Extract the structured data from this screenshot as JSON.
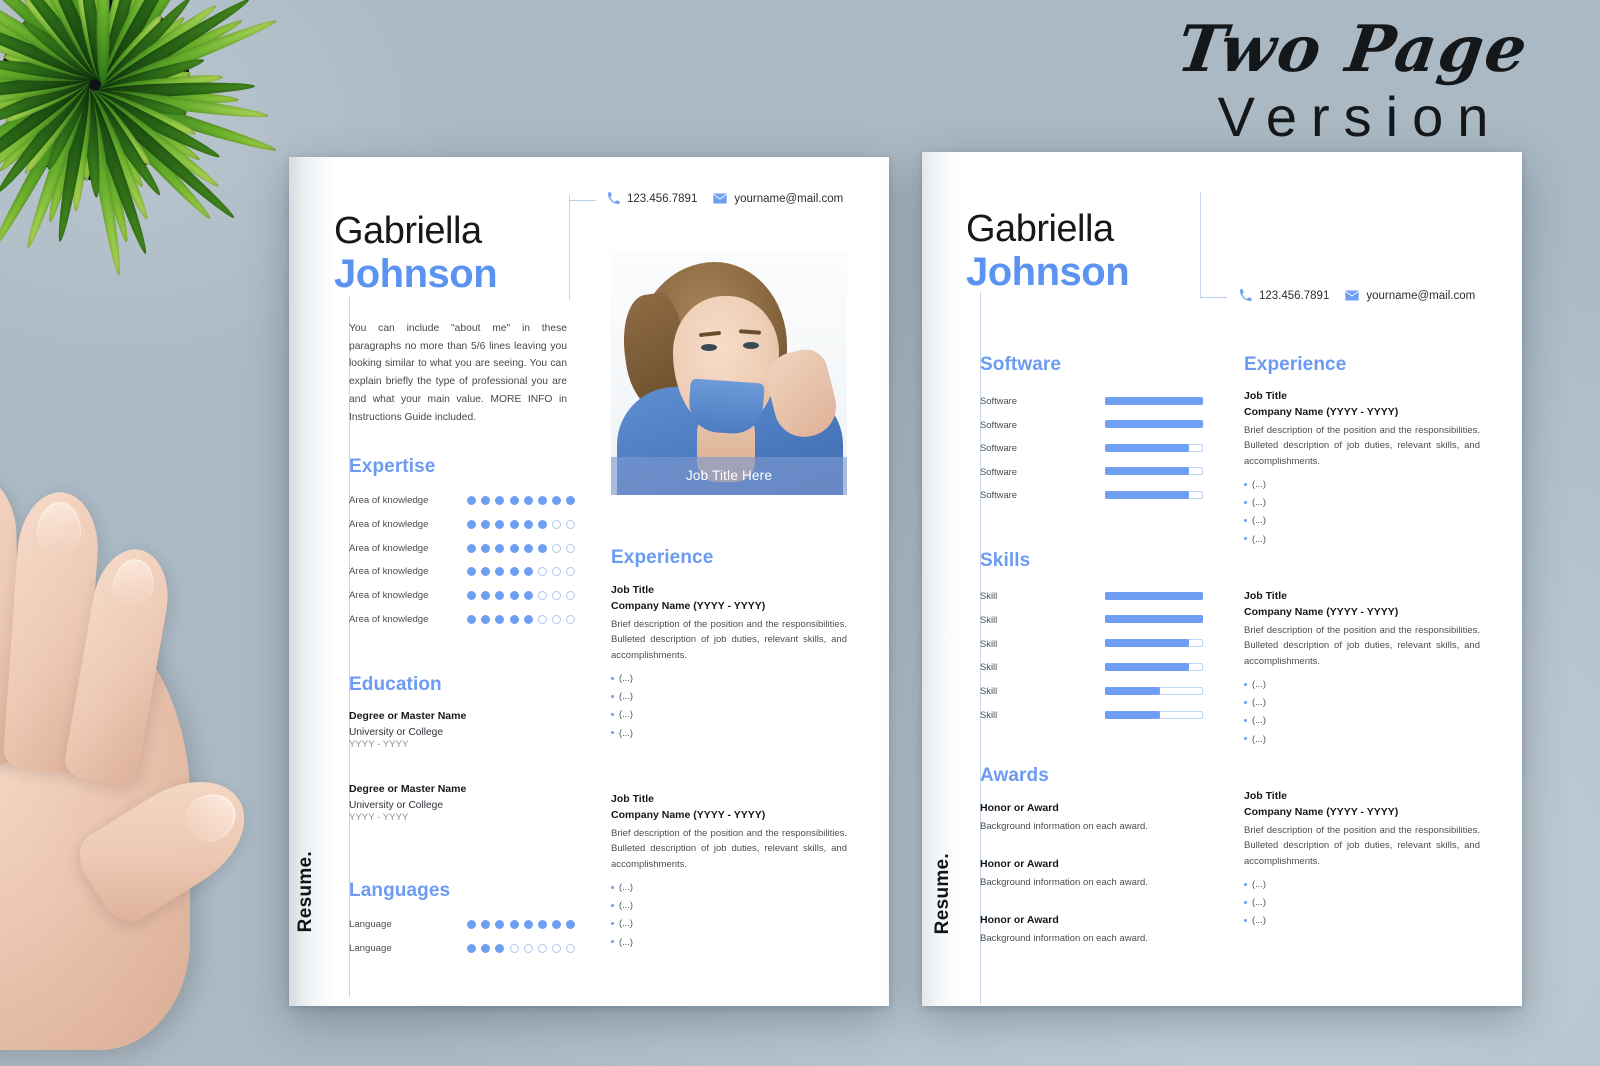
{
  "headline": {
    "line1": "Two Page",
    "line2": "Version"
  },
  "brand_color": "#6b9bf2",
  "side_label": "Resume.",
  "person": {
    "first_name": "Gabriella",
    "last_name": "Johnson"
  },
  "contact": {
    "phone": "123.456.7891",
    "email": "yourname@mail.com",
    "phone_icon": "phone-icon",
    "email_icon": "envelope-icon"
  },
  "page1": {
    "about": "You can include \"about me\" in these paragraphs no more than 5/6 lines leaving you looking similar to what you are seeing. You can explain briefly the type of professional you are and what your main value. MORE INFO in Instructions Guide included.",
    "photo_caption": "Job Title Here",
    "expertise": {
      "heading": "Expertise",
      "max": 8,
      "items": [
        {
          "label": "Area of knowledge",
          "value": 8
        },
        {
          "label": "Area of knowledge",
          "value": 6
        },
        {
          "label": "Area of knowledge",
          "value": 6
        },
        {
          "label": "Area of knowledge",
          "value": 5
        },
        {
          "label": "Area of knowledge",
          "value": 5
        },
        {
          "label": "Area of knowledge",
          "value": 5
        }
      ]
    },
    "education": {
      "heading": "Education",
      "items": [
        {
          "degree": "Degree or Master Name",
          "school": "University or College",
          "years": "YYYY - YYYY"
        },
        {
          "degree": "Degree or Master Name",
          "school": "University or College",
          "years": "YYYY - YYYY"
        }
      ]
    },
    "languages": {
      "heading": "Languages",
      "max": 8,
      "items": [
        {
          "label": "Language",
          "value": 8
        },
        {
          "label": "Language",
          "value": 3
        }
      ]
    },
    "experience": {
      "heading": "Experience",
      "items": [
        {
          "title": "Job Title",
          "company": "Company Name (YYYY - YYYY)",
          "description": "Brief description of the position and the responsibilities. Bulleted description of job duties, relevant skills, and accomplishments.",
          "bullets": [
            "(...)",
            "(...)",
            "(...)",
            "(...)"
          ]
        },
        {
          "title": "Job Title",
          "company": "Company Name (YYYY - YYYY)",
          "description": "Brief description of the position and the responsibilities. Bulleted description of job duties, relevant skills, and accomplishments.",
          "bullets": [
            "(...)",
            "(...)",
            "(...)",
            "(...)"
          ]
        }
      ]
    }
  },
  "page2": {
    "software": {
      "heading": "Software",
      "items": [
        {
          "label": "Software",
          "value": 100
        },
        {
          "label": "Software",
          "value": 100
        },
        {
          "label": "Software",
          "value": 85
        },
        {
          "label": "Software",
          "value": 85
        },
        {
          "label": "Software",
          "value": 85
        }
      ]
    },
    "skills": {
      "heading": "Skills",
      "items": [
        {
          "label": "Skill",
          "value": 100
        },
        {
          "label": "Skill",
          "value": 100
        },
        {
          "label": "Skill",
          "value": 85
        },
        {
          "label": "Skill",
          "value": 85
        },
        {
          "label": "Skill",
          "value": 55
        },
        {
          "label": "Skill",
          "value": 55
        }
      ]
    },
    "awards": {
      "heading": "Awards",
      "items": [
        {
          "title": "Honor or Award",
          "description": "Background information on each award."
        },
        {
          "title": "Honor or Award",
          "description": "Background information on each award."
        },
        {
          "title": "Honor or Award",
          "description": "Background information on each award."
        }
      ]
    },
    "experience": {
      "heading": "Experience",
      "items": [
        {
          "title": "Job Title",
          "company": "Company Name (YYYY - YYYY)",
          "description": "Brief description of the position and the responsibilities. Bulleted description of job duties, relevant skills, and accomplishments.",
          "bullets": [
            "(...)",
            "(...)",
            "(...)",
            "(...)"
          ]
        },
        {
          "title": "Job Title",
          "company": "Company Name (YYYY - YYYY)",
          "description": "Brief description of the position and the responsibilities. Bulleted description of job duties, relevant skills, and accomplishments.",
          "bullets": [
            "(...)",
            "(...)",
            "(...)",
            "(...)"
          ]
        },
        {
          "title": "Job Title",
          "company": "Company Name (YYYY - YYYY)",
          "description": "Brief description of the position and the responsibilities. Bulleted description of job duties, relevant skills, and accomplishments.",
          "bullets": [
            "(...)",
            "(...)",
            "(...)"
          ]
        }
      ]
    }
  }
}
